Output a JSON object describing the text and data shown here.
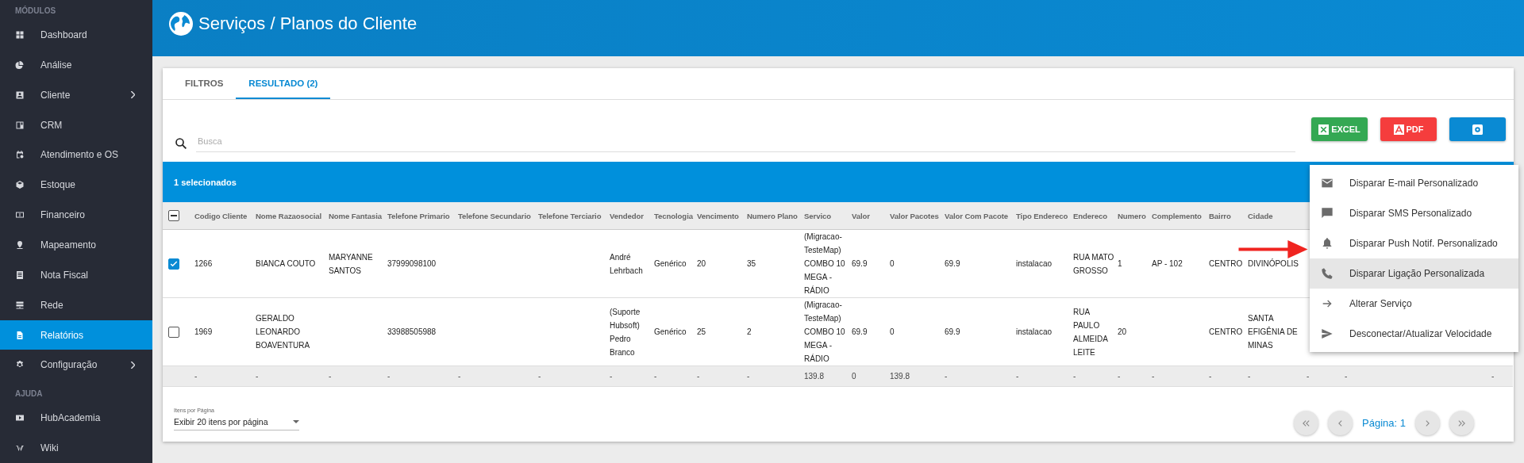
{
  "sidebar": {
    "sections": [
      {
        "title": "MÓDULOS",
        "items": [
          {
            "label": "Dashboard",
            "has_submenu": false,
            "selected": false
          },
          {
            "label": "Análise",
            "has_submenu": false,
            "selected": false
          },
          {
            "label": "Cliente",
            "has_submenu": true,
            "selected": false
          },
          {
            "label": "CRM",
            "has_submenu": false,
            "selected": false
          },
          {
            "label": "Atendimento e OS",
            "has_submenu": false,
            "selected": false
          },
          {
            "label": "Estoque",
            "has_submenu": false,
            "selected": false
          },
          {
            "label": "Financeiro",
            "has_submenu": false,
            "selected": false
          },
          {
            "label": "Mapeamento",
            "has_submenu": false,
            "selected": false
          },
          {
            "label": "Nota Fiscal",
            "has_submenu": false,
            "selected": false
          },
          {
            "label": "Rede",
            "has_submenu": false,
            "selected": false
          },
          {
            "label": "Relatórios",
            "has_submenu": false,
            "selected": true
          },
          {
            "label": "Configuração",
            "has_submenu": true,
            "selected": false
          }
        ]
      },
      {
        "title": "AJUDA",
        "items": [
          {
            "label": "HubAcademia",
            "has_submenu": false,
            "selected": false
          },
          {
            "label": "Wiki",
            "has_submenu": false,
            "selected": false
          }
        ]
      }
    ]
  },
  "header": {
    "title": "Serviços / Planos do Cliente"
  },
  "tabs": [
    {
      "label": "FILTROS",
      "selected": false
    },
    {
      "label": "RESULTADO (2)",
      "selected": true
    }
  ],
  "search": {
    "placeholder": "Busca"
  },
  "export_buttons": [
    {
      "label": "EXCEL",
      "kind": "excel"
    },
    {
      "label": "PDF",
      "kind": "pdf"
    },
    {
      "kind": "settings"
    }
  ],
  "selection_bar": {
    "text": "1 selecionados"
  },
  "table": {
    "indeterminate": true,
    "columns": [
      "Codigo Cliente",
      "Nome Razaosocial",
      "Nome Fantasia",
      "Telefone Primario",
      "Telefone Secundario",
      "Telefone Terciario",
      "Vendedor",
      "Tecnologia",
      "Vencimento",
      "Numero Plano",
      "Servico",
      "Valor",
      "Valor Pacotes",
      "Valor Com Pacote",
      "Tipo Endereco",
      "Endereco",
      "Numero",
      "Complemento",
      "Bairro",
      "Cidade"
    ],
    "rows": [
      {
        "selected": true,
        "cells": [
          "1266",
          "BIANCA COUTO",
          "MARYANNE SANTOS",
          "37999098100",
          "",
          "",
          "André Lehrbach",
          "Genérico",
          "20",
          "35",
          "(Migracao-TesteMap) COMBO 10 MEGA - RÁDIO",
          "69.9",
          "0",
          "69.9",
          "instalacao",
          "RUA MATO GROSSO",
          "1",
          "AP - 102",
          "CENTRO",
          "DIVINÓPOLIS"
        ]
      },
      {
        "selected": false,
        "cells": [
          "1969",
          "GERALDO LEONARDO BOAVENTURA",
          "",
          "33988505988",
          "",
          "",
          "(Suporte Hubsoft) Pedro Branco",
          "Genérico",
          "25",
          "2",
          "(Migracao-TesteMap) COMBO 10 MEGA - RÁDIO",
          "69.9",
          "0",
          "69.9",
          "instalacao",
          "RUA PAULO ALMEIDA LEITE",
          "20",
          "",
          "CENTRO",
          "SANTA EFIGÊNIA DE MINAS"
        ]
      }
    ],
    "totals": [
      "-",
      "-",
      "-",
      "-",
      "-",
      "-",
      "-",
      "-",
      "-",
      "-",
      "139.8",
      "0",
      "139.8",
      "-",
      "-",
      "-",
      "-",
      "-",
      "-",
      "-",
      "-",
      "-",
      "-"
    ]
  },
  "pagination": {
    "page_size_label": "Itens por Página",
    "page_size": "Exibir 20 itens por página",
    "page": "Página: 1"
  },
  "context_menu": {
    "items": [
      {
        "label": "Disparar E-mail Personalizado",
        "selected": false
      },
      {
        "label": "Disparar SMS Personalizado",
        "selected": false
      },
      {
        "label": "Disparar Push Notif. Personalizado",
        "selected": false
      },
      {
        "label": "Disparar Ligação Personalizada",
        "selected": true
      },
      {
        "label": "Alterar Serviço",
        "selected": false
      },
      {
        "label": "Desconectar/Atualizar Velocidade",
        "selected": false
      }
    ]
  }
}
